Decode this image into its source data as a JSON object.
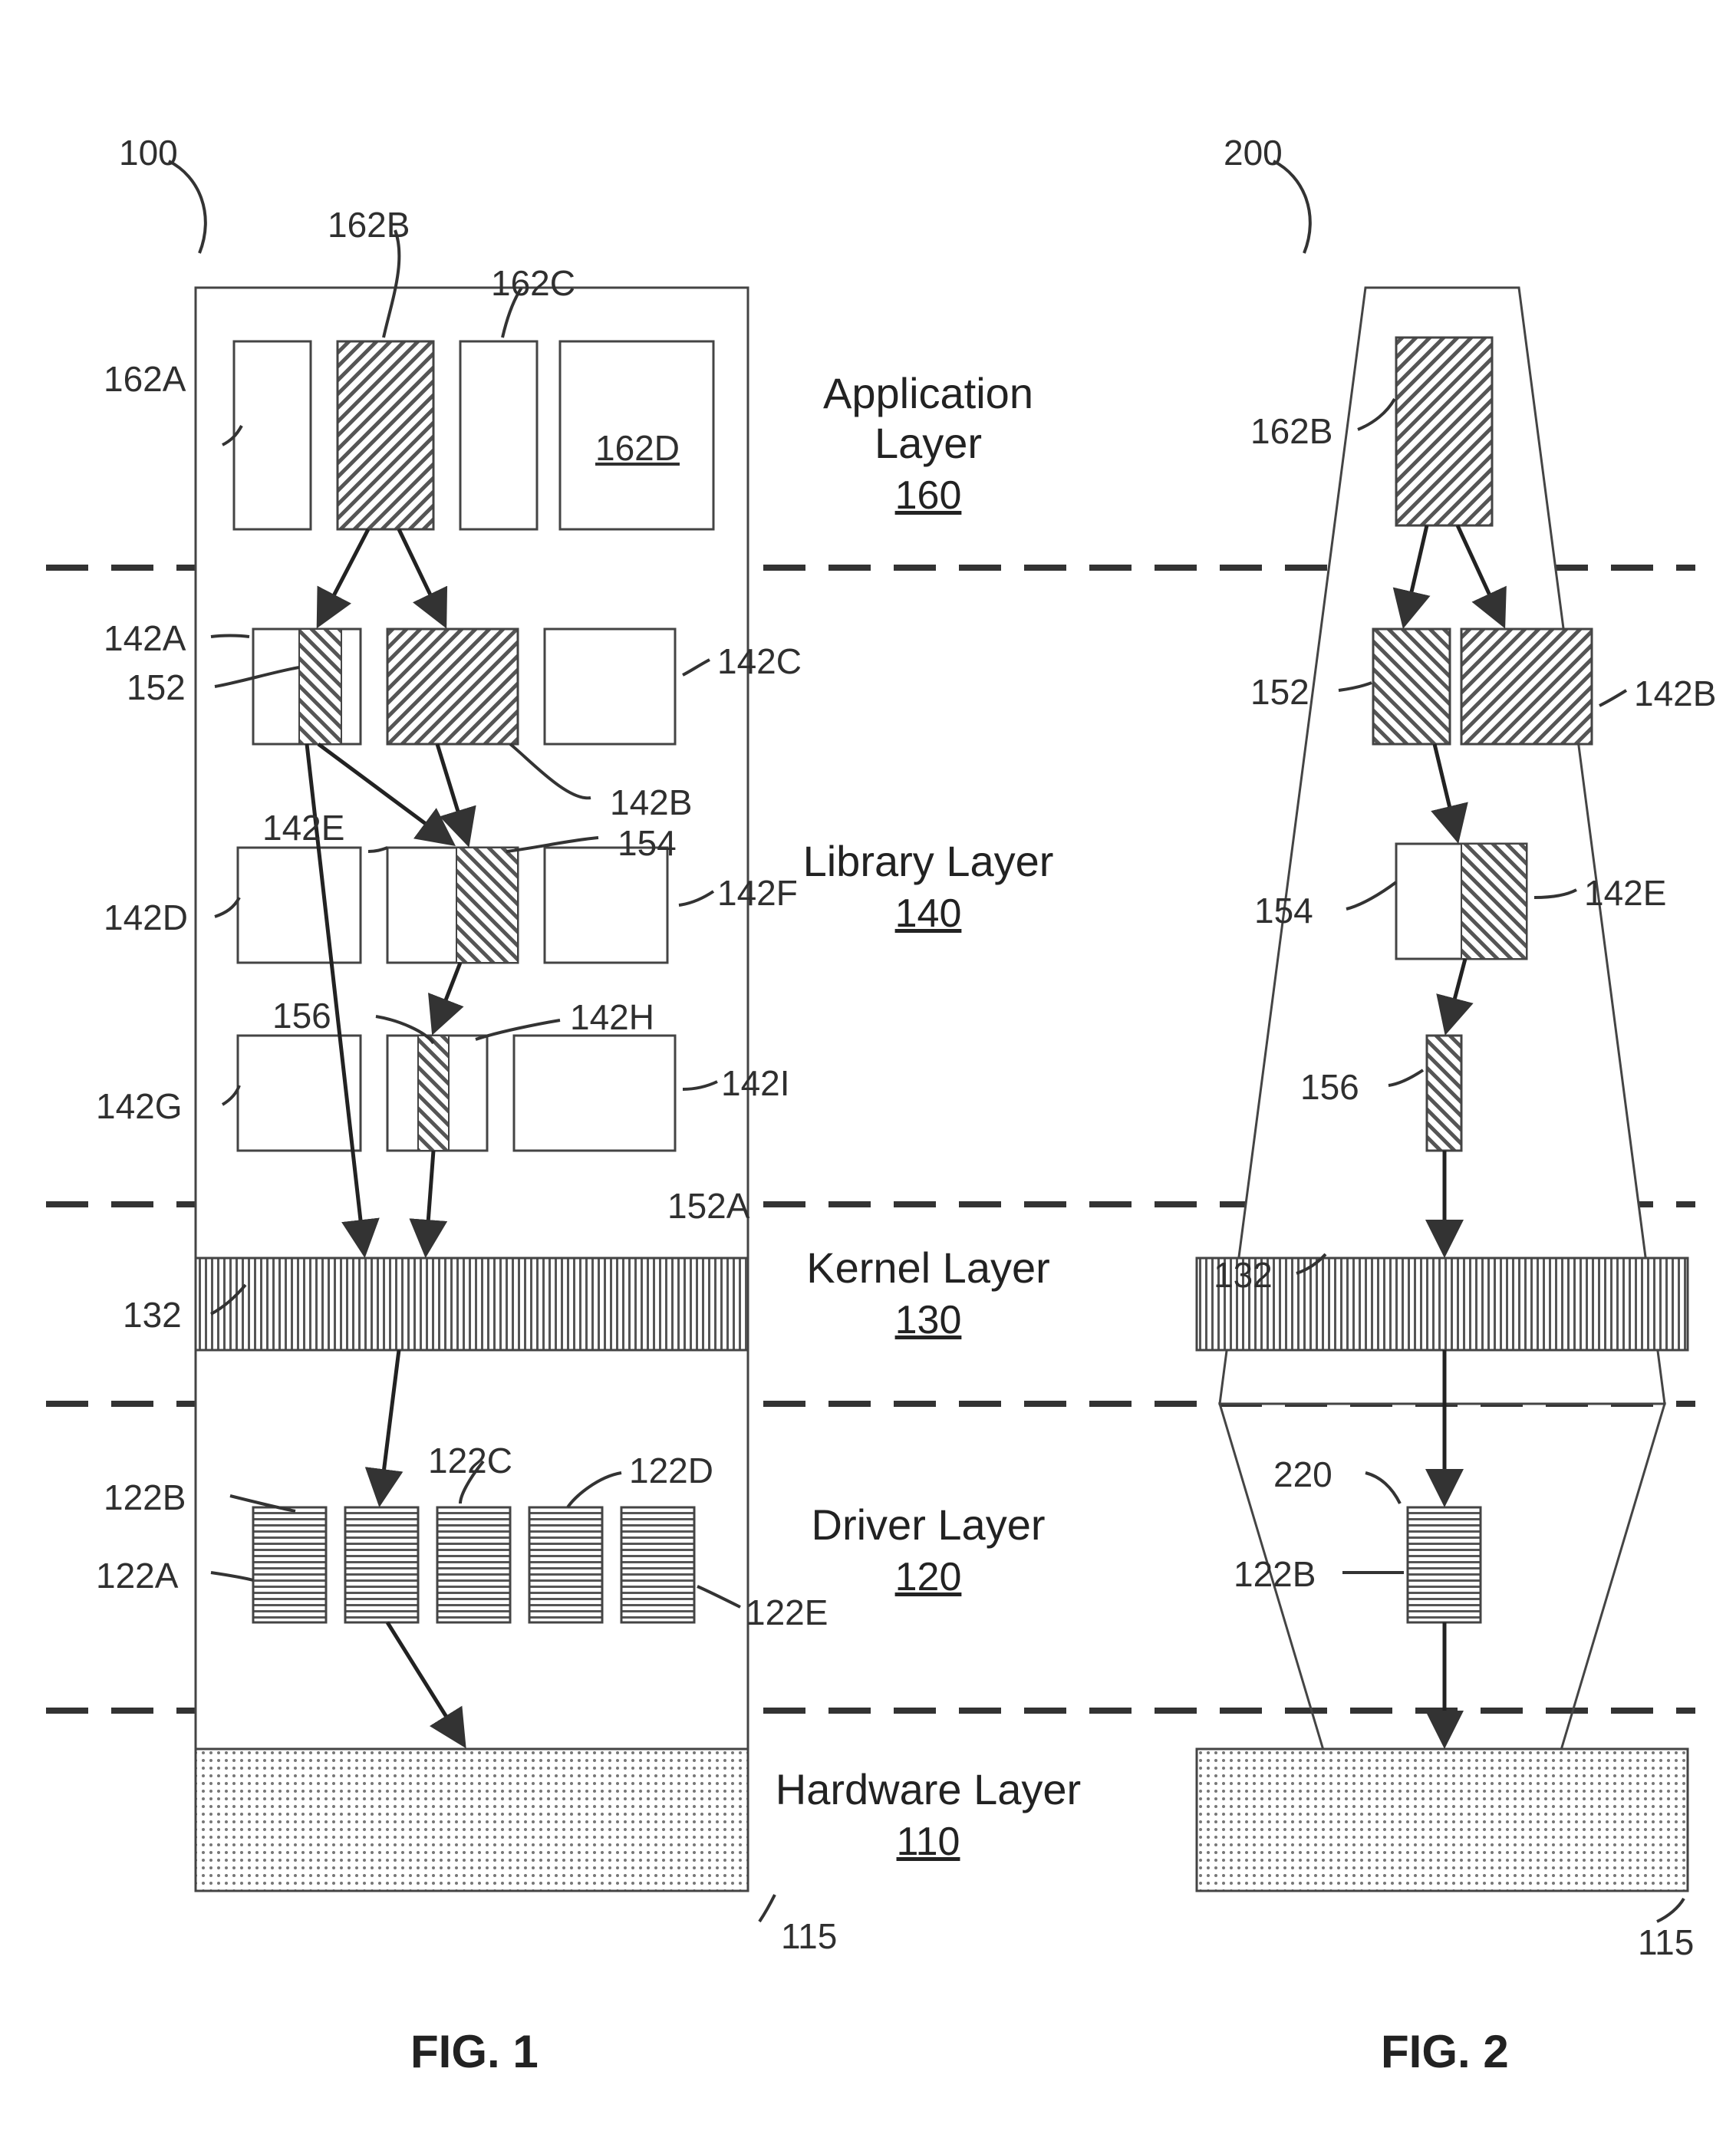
{
  "figures": {
    "fig1": "FIG. 1",
    "fig2": "FIG. 2"
  },
  "refs": {
    "n100": "100",
    "n200": "200",
    "n162A": "162A",
    "n162B": "162B",
    "n162C": "162C",
    "n162D": "162D",
    "n142A": "142A",
    "n142B": "142B",
    "n142C": "142C",
    "n142D": "142D",
    "n142E": "142E",
    "n142F": "142F",
    "n142G": "142G",
    "n142H": "142H",
    "n142I": "142I",
    "n152": "152",
    "n152A": "152A",
    "n154": "154",
    "n156": "156",
    "n132": "132",
    "n122A": "122A",
    "n122B": "122B",
    "n122C": "122C",
    "n122D": "122D",
    "n122E": "122E",
    "n115": "115",
    "n220": "220"
  },
  "layers": {
    "app": {
      "name": "Application Layer",
      "num": "160"
    },
    "lib": {
      "name": "Library Layer",
      "num": "140"
    },
    "kernel": {
      "name": "Kernel Layer",
      "num": "130"
    },
    "driver": {
      "name": "Driver Layer",
      "num": "120"
    },
    "hardware": {
      "name": "Hardware Layer",
      "num": "110"
    }
  },
  "chart_data": {
    "type": "diagram",
    "note": "Layered software-stack patent diagram – two figures showing call path from application down to hardware",
    "layers_order": [
      "Application Layer",
      "Library Layer",
      "Kernel Layer",
      "Driver Layer",
      "Hardware Layer"
    ],
    "fig1_components": {
      "Application Layer (160)": [
        "162A",
        "162B",
        "162C",
        "162D"
      ],
      "Library Layer (140) row1": [
        "142A (contains 152)",
        "142B",
        "142C"
      ],
      "Library Layer (140) row2": [
        "142D",
        "142E (contains 154)",
        "142F"
      ],
      "Library Layer (140) row3": [
        "142G",
        "142H (contains 156)",
        "142I"
      ],
      "Kernel Layer (130)": [
        "132"
      ],
      "Driver Layer (120)": [
        "122A",
        "122B",
        "122C",
        "122D",
        "122E"
      ],
      "Hardware Layer (110)": [
        "115"
      ],
      "boundary": "152A"
    },
    "fig1_arrows": [
      [
        "162B",
        "142A/152"
      ],
      [
        "162B",
        "142B"
      ],
      [
        "142A",
        "142E/154"
      ],
      [
        "142B",
        "142E/154"
      ],
      [
        "142E/154",
        "142H/156"
      ],
      [
        "142A",
        "132"
      ],
      [
        "142H",
        "132"
      ],
      [
        "132",
        "122B"
      ],
      [
        "122B",
        "115"
      ]
    ],
    "fig2_components": {
      "Application Layer": [
        "162B"
      ],
      "Library Layer": [
        "152",
        "142B",
        "154",
        "142E",
        "156"
      ],
      "Kernel Layer": [
        "132"
      ],
      "Driver Layer": [
        "122B",
        "220 (boundary)"
      ],
      "Hardware Layer": [
        "115"
      ]
    },
    "fig2_arrows": [
      [
        "162B",
        "152"
      ],
      [
        "162B",
        "142B"
      ],
      [
        "152/142B",
        "154/142E"
      ],
      [
        "154",
        "156"
      ],
      [
        "156",
        "132"
      ],
      [
        "132",
        "122B"
      ],
      [
        "122B",
        "115"
      ]
    ]
  }
}
